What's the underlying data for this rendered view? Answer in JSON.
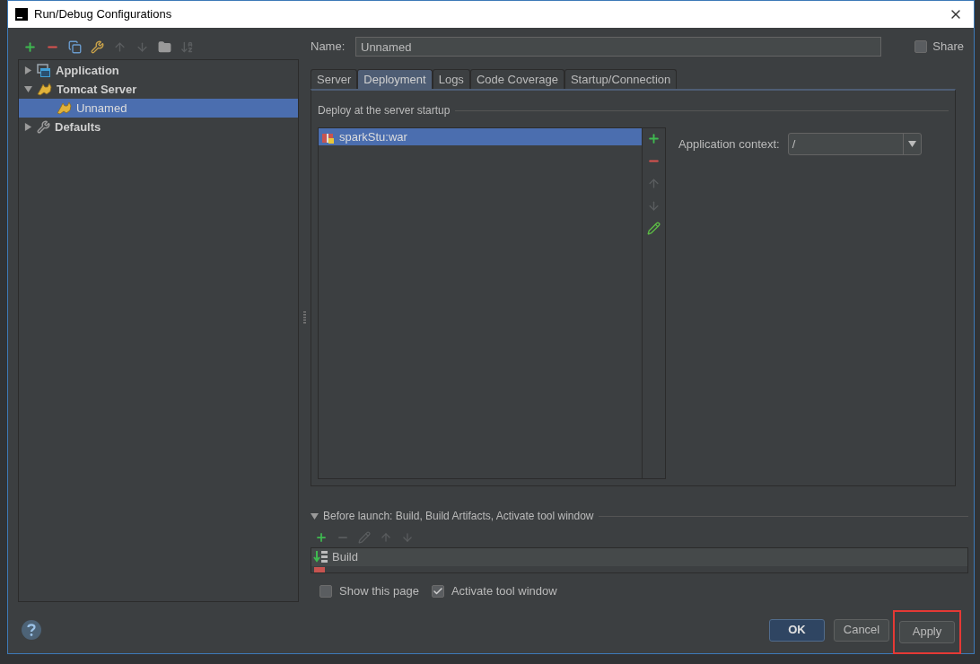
{
  "window": {
    "title": "Run/Debug Configurations"
  },
  "toolbar": [
    {
      "kind": "add",
      "disabled": false
    },
    {
      "kind": "remove",
      "disabled": false
    },
    {
      "kind": "copy",
      "disabled": false
    },
    {
      "kind": "edit-defaults",
      "disabled": false
    },
    {
      "kind": "up",
      "disabled": true
    },
    {
      "kind": "down",
      "disabled": true
    },
    {
      "kind": "folder",
      "disabled": false
    },
    {
      "kind": "sort",
      "disabled": true
    }
  ],
  "tree": [
    {
      "label": "Application",
      "kind": "application",
      "expanded": false,
      "selected": false,
      "bold": true
    },
    {
      "label": "Tomcat Server",
      "kind": "tomcat",
      "expanded": true,
      "selected": false,
      "bold": true,
      "children": [
        {
          "label": "Unnamed",
          "kind": "tomcat",
          "selected": true,
          "bold": false
        }
      ]
    },
    {
      "label": "Defaults",
      "kind": "defaults",
      "expanded": false,
      "selected": false,
      "bold": true
    }
  ],
  "name_field": {
    "label": "Name:",
    "value": "Unnamed"
  },
  "share": {
    "label": "Share",
    "checked": false
  },
  "tabs": [
    {
      "label": "Server",
      "selected": false
    },
    {
      "label": "Deployment",
      "selected": true
    },
    {
      "label": "Logs",
      "selected": false
    },
    {
      "label": "Code Coverage",
      "selected": false
    },
    {
      "label": "Startup/Connection",
      "selected": false
    }
  ],
  "deployment": {
    "title": "Deploy at the server startup",
    "artifacts": [
      {
        "label": "sparkStu:war",
        "selected": true
      }
    ],
    "side_toolbar": [
      {
        "kind": "add",
        "disabled": false
      },
      {
        "kind": "remove",
        "disabled": false
      },
      {
        "kind": "up",
        "disabled": true
      },
      {
        "kind": "down",
        "disabled": true
      },
      {
        "kind": "edit",
        "disabled": false
      }
    ],
    "context_label": "Application context:",
    "context_value": "/"
  },
  "before_launch": {
    "title": "Before launch: Build, Build Artifacts, Activate tool window",
    "expanded": true,
    "toolbar": [
      {
        "kind": "add",
        "disabled": false
      },
      {
        "kind": "remove",
        "disabled": true
      },
      {
        "kind": "edit",
        "disabled": true
      },
      {
        "kind": "up",
        "disabled": true
      },
      {
        "kind": "down",
        "disabled": true
      }
    ],
    "tasks": [
      {
        "label": "Build",
        "kind": "build"
      },
      {
        "kind": "artifact"
      }
    ]
  },
  "options": [
    {
      "label": "Show this page",
      "checked": false
    },
    {
      "label": "Activate tool window",
      "checked": true
    }
  ],
  "buttons": [
    {
      "label": "OK",
      "kind": "default",
      "highlighted": false
    },
    {
      "label": "Cancel",
      "kind": "normal",
      "highlighted": false
    },
    {
      "label": "Apply",
      "kind": "normal",
      "highlighted": true
    }
  ]
}
